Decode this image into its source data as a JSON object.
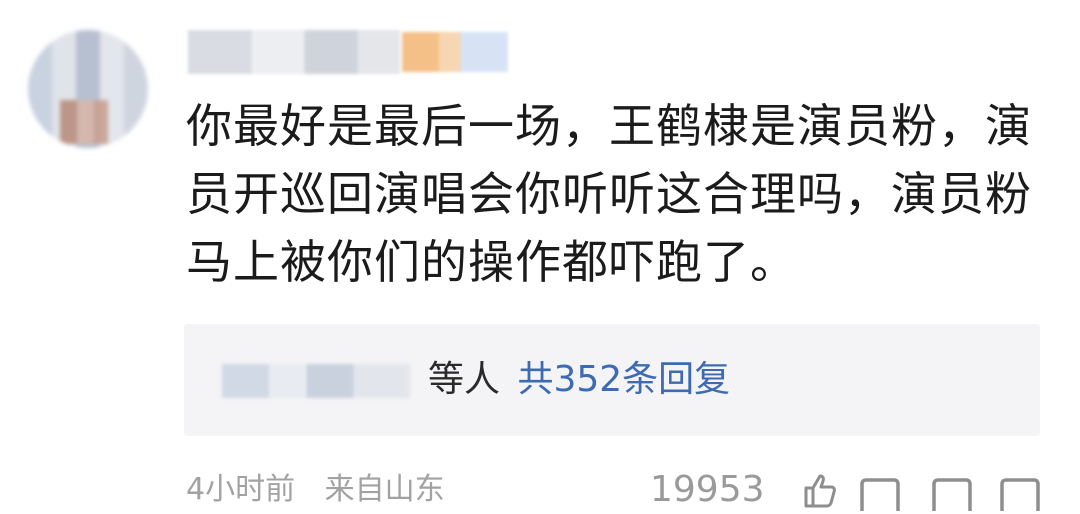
{
  "comment": {
    "lines": [
      "你最好是最后一场，王鹤棣是演员粉，演",
      "员开巡回演唱会你听听这合理吗，演员粉",
      "马上被你们的操作都吓跑了。"
    ]
  },
  "replies": {
    "suffix": "等人",
    "link": "共352条回复"
  },
  "meta": {
    "time": "4小时前",
    "location": "来自山东",
    "likes": "19953"
  },
  "icons": [
    "thumbs-up-icon",
    "reply-icon",
    "comment-icon",
    "more-icon"
  ],
  "colors": {
    "link": "#3d6bb3",
    "meta": "#a2a2a2",
    "reply_bg": "#f4f4f6"
  }
}
